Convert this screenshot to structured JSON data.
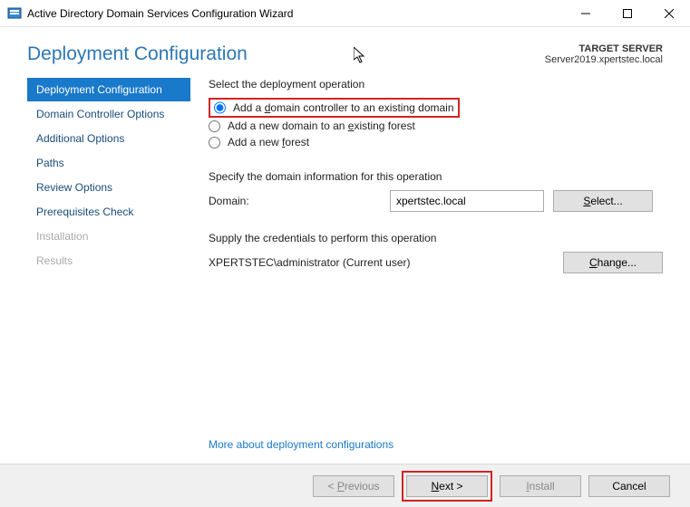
{
  "window": {
    "title": "Active Directory Domain Services Configuration Wizard"
  },
  "header": {
    "heading": "Deployment Configuration",
    "target_label": "TARGET SERVER",
    "target_value": "Server2019.xpertstec.local"
  },
  "sidebar": {
    "steps": [
      {
        "label": "Deployment Configuration",
        "state": "active"
      },
      {
        "label": "Domain Controller Options",
        "state": "normal"
      },
      {
        "label": "Additional Options",
        "state": "normal"
      },
      {
        "label": "Paths",
        "state": "normal"
      },
      {
        "label": "Review Options",
        "state": "normal"
      },
      {
        "label": "Prerequisites Check",
        "state": "normal"
      },
      {
        "label": "Installation",
        "state": "disabled"
      },
      {
        "label": "Results",
        "state": "disabled"
      }
    ]
  },
  "content": {
    "select_operation_label": "Select the deployment operation",
    "radios": {
      "add_dc": {
        "pre": "Add a ",
        "u": "d",
        "post": "omain controller to an existing domain"
      },
      "add_domain": {
        "pre": "Add a new domain to an ",
        "u": "e",
        "post": "xisting forest"
      },
      "new_forest": {
        "pre": "Add a new ",
        "u": "f",
        "post": "orest"
      }
    },
    "specify_domain_label": "Specify the domain information for this operation",
    "domain_label": "Domain:",
    "domain_value": "xpertstec.local",
    "select_btn": {
      "pre": "",
      "u": "S",
      "post": "elect..."
    },
    "credentials_label": "Supply the credentials to perform this operation",
    "credentials_value": "XPERTSTEC\\administrator (Current user)",
    "change_btn": {
      "pre": "",
      "u": "C",
      "post": "hange..."
    },
    "more_link": "More about deployment configurations"
  },
  "footer": {
    "previous": {
      "pre": "< ",
      "u": "P",
      "post": "revious"
    },
    "next": {
      "pre": "",
      "u": "N",
      "post": "ext >"
    },
    "install": {
      "pre": "",
      "u": "I",
      "post": "nstall"
    },
    "cancel": "Cancel"
  }
}
